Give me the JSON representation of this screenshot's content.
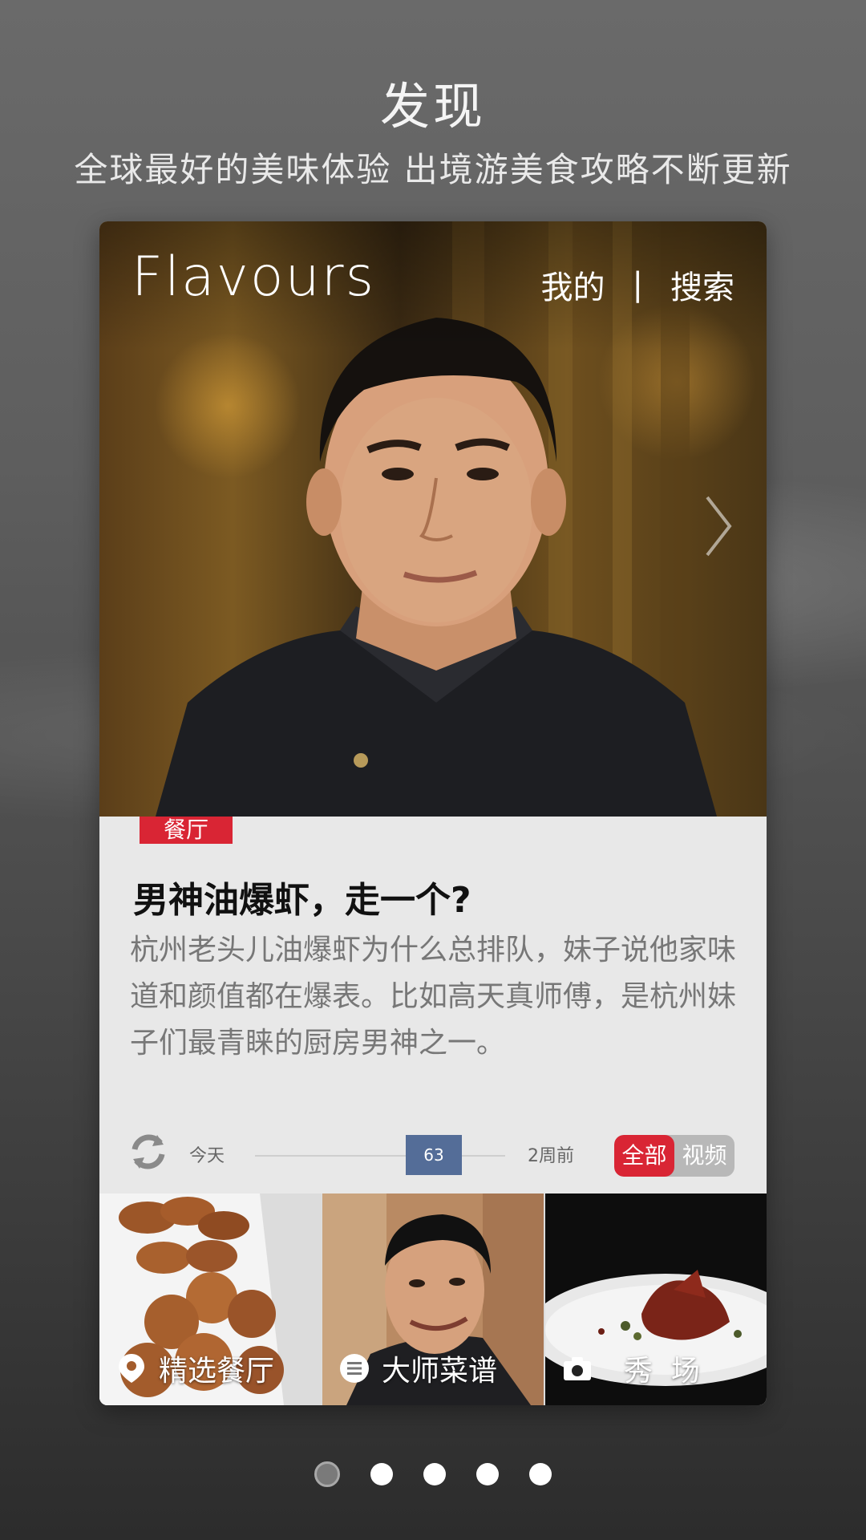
{
  "page": {
    "title": "发现",
    "subtitle": "全球最好的美味体验 出境游美食攻略不断更新"
  },
  "card": {
    "brand": "Flavours",
    "nav": {
      "mine": "我的",
      "separator": "|",
      "search": "搜索"
    },
    "tag": "餐厅",
    "article_title": "男神油爆虾，走一个?",
    "article_body": "杭州老头儿油爆虾为什么总排队，妹子说他家味道和颜值都在爆表。比如高天真师傅，是杭州妹子们最青睐的厨房男神之一。",
    "timeline": {
      "start_label": "今天",
      "value": "63",
      "end_label": "2周前",
      "filters": [
        "全部",
        "视频"
      ],
      "active_filter": "全部"
    },
    "tiles": [
      {
        "label": "精选餐厅",
        "icon": "location-pin-icon"
      },
      {
        "label": "大师菜谱",
        "icon": "menu-list-icon"
      },
      {
        "label": "秀  场",
        "icon": "camera-icon"
      }
    ]
  },
  "pagination": {
    "count": 5,
    "active_index": 0
  },
  "colors": {
    "accent": "#d92534",
    "slider_thumb": "#546d98"
  }
}
